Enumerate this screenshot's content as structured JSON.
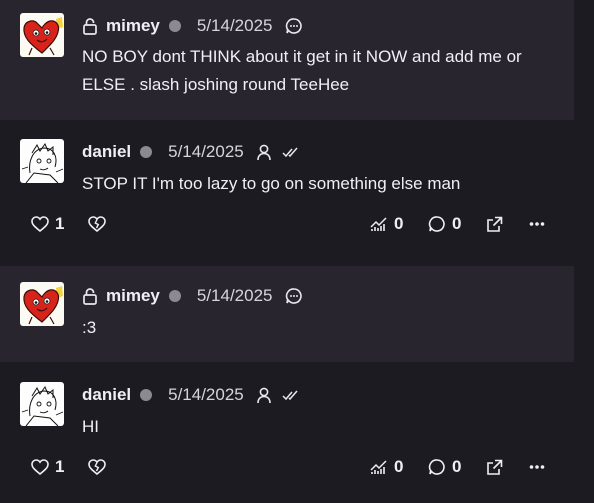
{
  "messages": [
    {
      "username": "mimey",
      "date": "5/14/2025",
      "text": "NO BOY dont THINK about it get in it NOW and add me or ELSE . slash joshing round TeeHee",
      "icons": [
        "lock-icon",
        "status-dot",
        "chat-bubble-icon"
      ]
    },
    {
      "username": "daniel",
      "date": "5/14/2025",
      "text": "STOP IT I'm too lazy to go on something else man",
      "icons": [
        "status-dot",
        "person-icon",
        "double-check-icon"
      ],
      "likes": "1",
      "views": "0",
      "comments": "0"
    },
    {
      "username": "mimey",
      "date": "5/14/2025",
      "text": ":3",
      "icons": [
        "lock-icon",
        "status-dot",
        "chat-bubble-icon"
      ]
    },
    {
      "username": "daniel",
      "date": "5/14/2025",
      "text": "HI",
      "icons": [
        "status-dot",
        "person-icon",
        "double-check-icon"
      ],
      "likes": "1",
      "views": "0",
      "comments": "0"
    }
  ],
  "colors": {
    "background": "#1c1b22",
    "reply_card": "#28252f",
    "status_dot": "#8b8a90",
    "text": "#f1eff5"
  }
}
